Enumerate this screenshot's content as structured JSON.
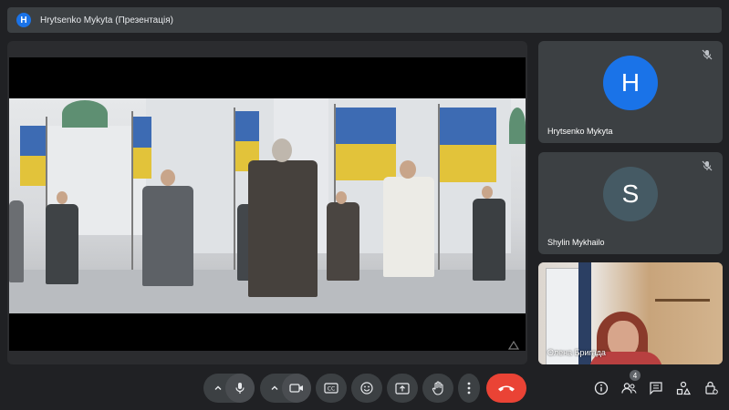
{
  "topbar": {
    "avatar_letter": "H",
    "title": "Hrytsenko Mykyta (Презентація)"
  },
  "participants": [
    {
      "avatar_letter": "H",
      "name": "Hrytsenko Mykyta",
      "avatar_color": "#1a73e8",
      "muted": true
    },
    {
      "avatar_letter": "S",
      "name": "Shylin Mykhailo",
      "avatar_color": "#455a64",
      "muted": true
    }
  ],
  "self_view": {
    "name": "Олена Бригада"
  },
  "controls": {
    "participants_count": "4",
    "end_call_color": "#ea4335",
    "icons": [
      "chevron-up-icon",
      "mic-icon",
      "chevron-up-icon",
      "camera-icon",
      "captions-icon",
      "emoji-icon",
      "present-icon",
      "raise-hand-icon",
      "more-vert-icon",
      "end-call-icon"
    ],
    "right_icons": [
      "info-icon",
      "people-icon",
      "chat-icon",
      "activities-icon",
      "host-controls-icon"
    ]
  },
  "colors": {
    "background": "#202124",
    "tile": "#3c4043",
    "accent": "#1a73e8"
  }
}
